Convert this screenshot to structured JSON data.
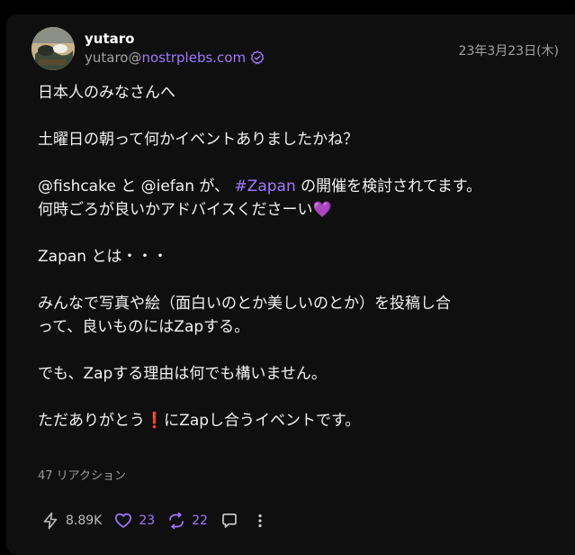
{
  "author": {
    "name": "yutaro",
    "nip05_user": "yutaro@",
    "nip05_domain": "nostrplebs.com"
  },
  "date": "23年3月23日(木)",
  "content": {
    "line1": "日本人のみなさんへ",
    "line2": "土曜日の朝って何かイベントありましたかね？",
    "line3a": "@fishcake と @iefan が、 ",
    "line3_hashtag": "#Zapan",
    "line3b": " の開催を検討されてます。",
    "line4": "何時ごろが良いかアドバイスくださーい💜",
    "line5": "Zapan とは・・・",
    "line6": "みんなで写真や絵（面白いのとか美しいのとか）を投稿し合",
    "line7": "って、良いものにはZapする。",
    "line8": "でも、Zapする理由は何でも構いません。",
    "line9": "ただありがとう❗️にZapし合うイベントです。"
  },
  "reactions_label": "47 リアクション",
  "actions": {
    "zap_count": "8.89K",
    "like_count": "23",
    "repost_count": "22"
  },
  "colors": {
    "accent": "#a078ff",
    "background": "#000000",
    "card": "#0f0f0f",
    "muted": "#a3a3a3"
  },
  "icons": [
    "verified-icon",
    "zap-icon",
    "heart-icon",
    "repost-icon",
    "reply-icon",
    "more-icon"
  ]
}
